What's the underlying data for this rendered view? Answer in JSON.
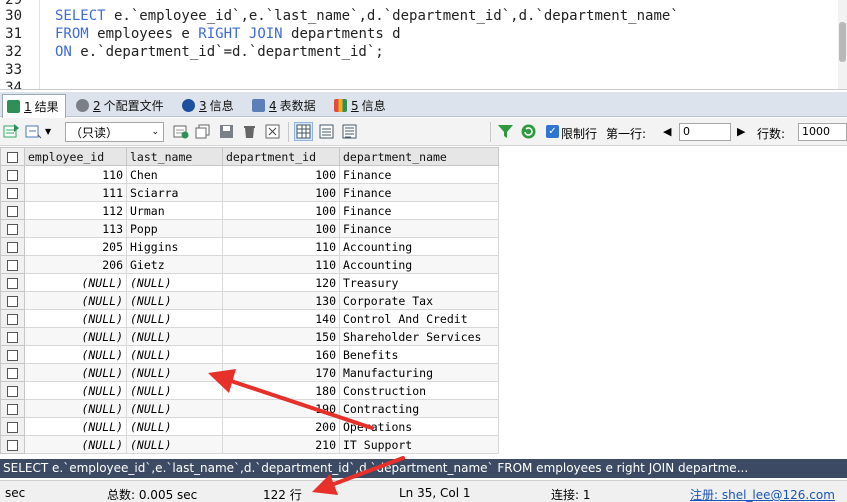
{
  "editor": {
    "lines": [
      {
        "num": "29",
        "text": ""
      },
      {
        "num": "30",
        "text": "SELECT e.`employee_id`,e.`last_name`,d.`department_id`,d.`department_name`"
      },
      {
        "num": "31",
        "text": "FROM employees e RIGHT JOIN departments d"
      },
      {
        "num": "32",
        "text": "ON e.`department_id`=d.`department_id`;"
      },
      {
        "num": "33",
        "text": ""
      },
      {
        "num": "34",
        "text": ""
      }
    ]
  },
  "tabs": [
    {
      "num": "1",
      "label": "结果",
      "icon": "results-grid-icon",
      "active": true
    },
    {
      "num": "2",
      "label": "个配置文件",
      "icon": "profile-icon",
      "active": false
    },
    {
      "num": "3",
      "label": "信息",
      "icon": "info-icon",
      "active": false
    },
    {
      "num": "4",
      "label": "表数据",
      "icon": "table-data-icon",
      "active": false
    },
    {
      "num": "5",
      "label": "信息",
      "icon": "info-multi-icon",
      "active": false
    }
  ],
  "toolbar": {
    "mode_value": "（只读）",
    "limit_label": "限制行",
    "first_row_label": "第一行:",
    "first_row_value": "0",
    "rows_label": "行数:",
    "rows_value": "1000"
  },
  "grid": {
    "columns": [
      "employee_id",
      "last_name",
      "department_id",
      "department_name"
    ],
    "rows": [
      [
        "110",
        "Chen",
        "100",
        "Finance"
      ],
      [
        "111",
        "Sciarra",
        "100",
        "Finance"
      ],
      [
        "112",
        "Urman",
        "100",
        "Finance"
      ],
      [
        "113",
        "Popp",
        "100",
        "Finance"
      ],
      [
        "205",
        "Higgins",
        "110",
        "Accounting"
      ],
      [
        "206",
        "Gietz",
        "110",
        "Accounting"
      ],
      [
        "(NULL)",
        "(NULL)",
        "120",
        "Treasury"
      ],
      [
        "(NULL)",
        "(NULL)",
        "130",
        "Corporate Tax"
      ],
      [
        "(NULL)",
        "(NULL)",
        "140",
        "Control And Credit"
      ],
      [
        "(NULL)",
        "(NULL)",
        "150",
        "Shareholder Services"
      ],
      [
        "(NULL)",
        "(NULL)",
        "160",
        "Benefits"
      ],
      [
        "(NULL)",
        "(NULL)",
        "170",
        "Manufacturing"
      ],
      [
        "(NULL)",
        "(NULL)",
        "180",
        "Construction"
      ],
      [
        "(NULL)",
        "(NULL)",
        "190",
        "Contracting"
      ],
      [
        "(NULL)",
        "(NULL)",
        "200",
        "Operations"
      ],
      [
        "(NULL)",
        "(NULL)",
        "210",
        "IT Support"
      ]
    ]
  },
  "query_bar": "SELECT e.`employee_id`,e.`last_name`,d.`department_id`,d.`department_name` FROM employees e right JOIN departme...",
  "status": {
    "sec_label": "sec",
    "time": "总数: 0.005 sec",
    "rows": "122 行",
    "position": "Ln 35, Col 1",
    "connections": "连接: 1",
    "registration": "注册: shel_lee@126.com"
  },
  "colors": {
    "keyword": "#3e6bd6",
    "annotation_arrow": "#e8302a",
    "query_bar_bg": "#3c4b63"
  }
}
